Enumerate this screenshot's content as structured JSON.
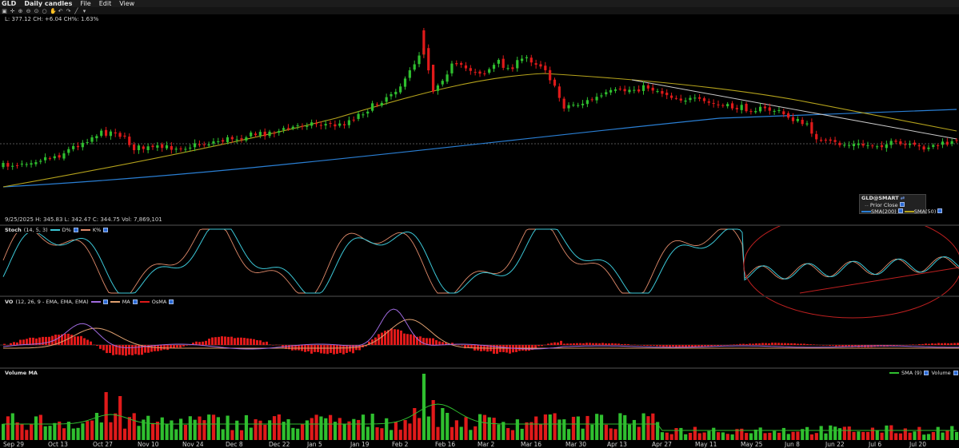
{
  "menubar": {
    "symbol": "GLD",
    "interval": "Daily candles",
    "file": "File",
    "edit": "Edit",
    "view": "View"
  },
  "toolbar": {
    "icons": [
      "select-icon",
      "crosshair-icon",
      "zoom-in-icon",
      "zoom-out-icon",
      "zoom-fit-icon",
      "circle-icon",
      "hand-icon",
      "undo-icon",
      "redo-icon",
      "draw-line-icon",
      "annotate-icon"
    ]
  },
  "price_panel": {
    "last_quote": "L: 377.12 CH: +6.04 CH%: 1.63%",
    "bar_info": "9/25/2025  H: 345.83  L: 342.47  C: 344.75  Vol: 7,869,101",
    "legend": {
      "title": "GLD@SMART",
      "prior_close": "Prior Close",
      "sma200": "SMA(200)",
      "sma50": "SMA(50)"
    },
    "colors": {
      "up": "#2fbf2f",
      "down": "#e01a1a",
      "sma50": "#b5a31c",
      "sma200": "#2a7fd4",
      "trend": "#c9c9c9"
    }
  },
  "stoch_panel": {
    "title": "Stoch",
    "params": "(14, 5, 3)",
    "d_label": "D%",
    "k_label": "K%",
    "colors": {
      "d": "#3cc8d8",
      "k": "#e08a6a"
    }
  },
  "vo_panel": {
    "title": "VO",
    "params": "(12, 26, 9 - EMA, EMA, EMA)",
    "ma_label": "MA",
    "osma_label": "OsMA",
    "colors": {
      "vo": "#a06be0",
      "ma": "#e0a070",
      "osma": "#e01a1a"
    }
  },
  "volume_panel": {
    "title": "Volume MA",
    "sma_label": "SMA (9)",
    "volume_label": "Volume"
  },
  "x_axis": [
    "Sep 29",
    "Oct 13",
    "Oct 27",
    "Nov 10",
    "Nov 24",
    "Dec 8",
    "Dec 22",
    "Jan 5",
    "Jan 19",
    "Feb 2",
    "Feb 16",
    "Mar 2",
    "Mar 16",
    "Mar 30",
    "Apr 13",
    "Apr 27",
    "May 11",
    "May 25",
    "Jun 8",
    "Jun 22",
    "Jul 6",
    "Jul 20"
  ]
}
